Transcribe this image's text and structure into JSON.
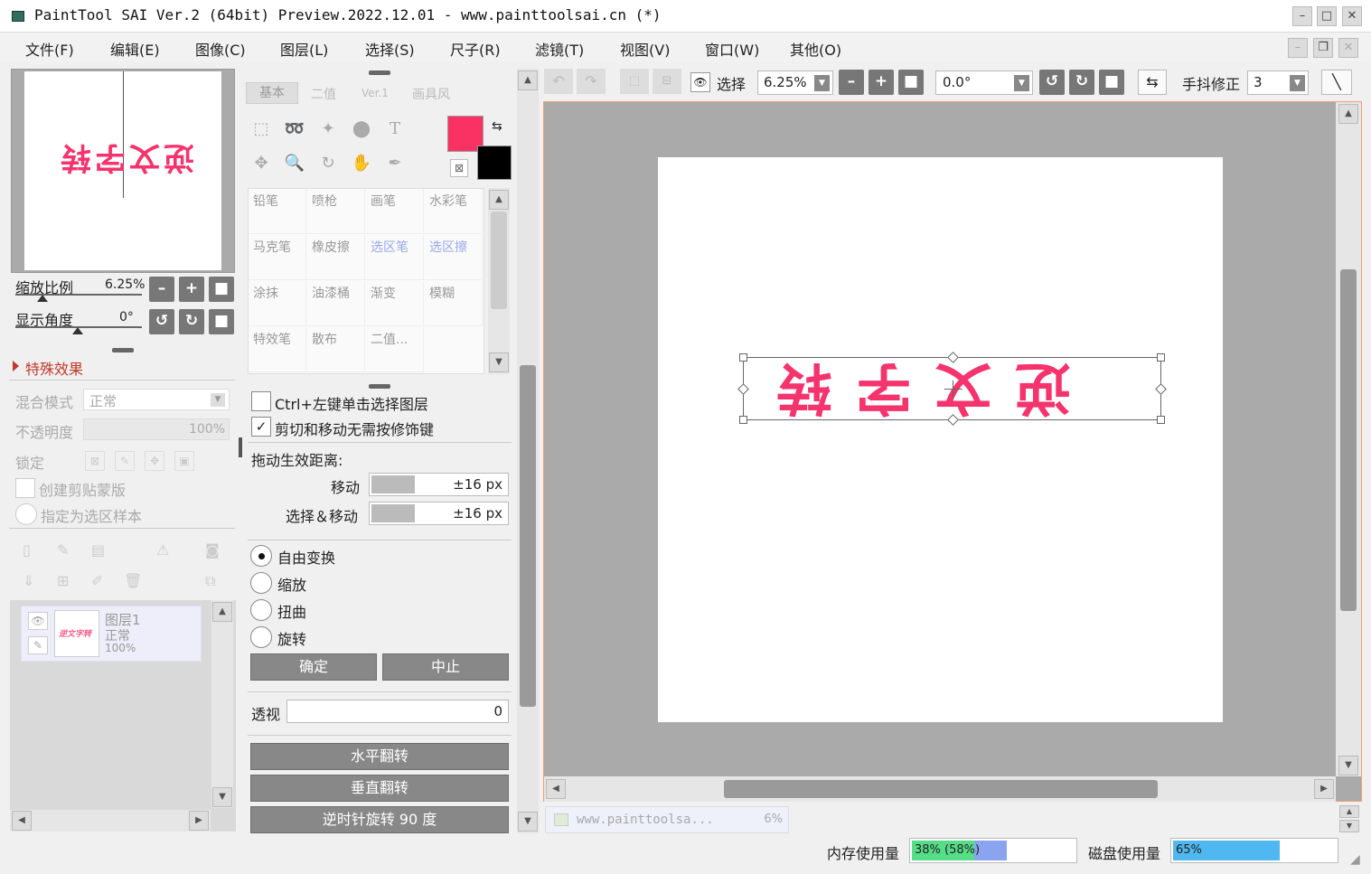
{
  "window": {
    "title": "PaintTool SAI Ver.2 (64bit) Preview.2022.12.01 - www.painttoolsai.cn (*)"
  },
  "menu": [
    "文件(F)",
    "编辑(E)",
    "图像(C)",
    "图层(L)",
    "选择(S)",
    "尺子(R)",
    "滤镜(T)",
    "视图(V)",
    "窗口(W)",
    "其他(O)"
  ],
  "navigator": {
    "zoom_label": "缩放比例",
    "zoom_value": "6.25%",
    "angle_label": "显示角度",
    "angle_value": "0°",
    "thumb_text": "逆文字转"
  },
  "effects": {
    "title": "特殊效果"
  },
  "layer_props": {
    "blend_label": "混合模式",
    "blend_value": "正常",
    "opacity_label": "不透明度",
    "opacity_value": "100%",
    "lock_label": "锁定",
    "clip_label": "创建剪贴蒙版",
    "sample_label": "指定为选区样本"
  },
  "layers": [
    {
      "name": "图层1",
      "mode": "正常",
      "opacity": "100%",
      "thumb_text": "逆文字转"
    }
  ],
  "tool_tabs": [
    "基本",
    "二值",
    "Ver.1",
    "画具风"
  ],
  "colors": {
    "primary": "#fa3264",
    "secondary": "#000000",
    "accent": "#f5336d",
    "memory_bar": "#8aa4f0",
    "memory_green": "#55dd88",
    "disk_bar": "#4fb8f0"
  },
  "brushes": [
    [
      "铅笔",
      "喷枪",
      "画笔",
      "水彩笔"
    ],
    [
      "马克笔",
      "橡皮擦",
      "选区笔",
      "选区擦"
    ],
    [
      "涂抹",
      "油漆桶",
      "渐变",
      "模糊"
    ],
    [
      "特效笔",
      "散布",
      "二值..."
    ]
  ],
  "transform": {
    "ctrl_click": "Ctrl+左键单击选择图层",
    "cut_move": "剪切和移动无需按修饰键",
    "drag_distance": "拖动生效距离:",
    "move_label": "移动",
    "move_value": "±16 px",
    "select_move_label": "选择＆移动",
    "select_move_value": "±16 px",
    "modes": [
      "自由变换",
      "缩放",
      "扭曲",
      "旋转"
    ],
    "selected_mode": "自由变换",
    "ok": "确定",
    "cancel": "中止",
    "perspective_label": "透视",
    "perspective_value": "0",
    "flip_h": "水平翻转",
    "flip_v": "垂直翻转",
    "rotate_ccw": "逆时针旋转 90 度"
  },
  "toolbar": {
    "select_label": "选择",
    "zoom_value": "6.25%",
    "angle_value": "0.0°",
    "stabilizer_label": "手抖修正",
    "stabilizer_value": "3"
  },
  "canvas": {
    "text": "逆文字转"
  },
  "doc_tab": {
    "name": "www.painttoolsa...",
    "zoom": "6%"
  },
  "status": {
    "memory_label": "内存使用量",
    "memory_value": "38% (58%)",
    "memory_pct": 0.38,
    "memory_peak_pct": 0.58,
    "disk_label": "磁盘使用量",
    "disk_value": "65%",
    "disk_pct": 0.65
  }
}
